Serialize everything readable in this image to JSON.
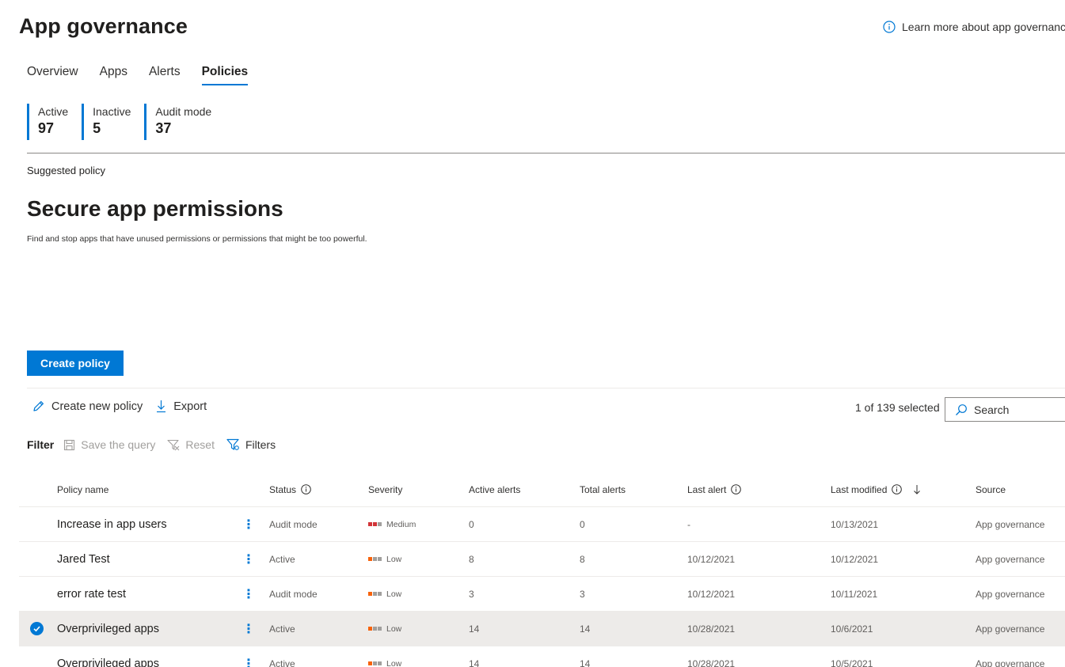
{
  "header": {
    "title": "App governance",
    "learn_more": "Learn more about app governance"
  },
  "tabs": [
    {
      "label": "Overview",
      "active": false
    },
    {
      "label": "Apps",
      "active": false
    },
    {
      "label": "Alerts",
      "active": false
    },
    {
      "label": "Policies",
      "active": true
    }
  ],
  "stats": [
    {
      "label": "Active",
      "value": "97"
    },
    {
      "label": "Inactive",
      "value": "5"
    },
    {
      "label": "Audit mode",
      "value": "37"
    }
  ],
  "suggested": {
    "label": "Suggested policy",
    "title": "Secure app permissions",
    "description": "Find and stop apps that have unused permissions or permissions that might be too powerful."
  },
  "create_button": "Create policy",
  "toolbar": {
    "create_new": "Create new policy",
    "export": "Export",
    "selected_count": "1 of 139 selected",
    "search_placeholder": "Search"
  },
  "filterbar": {
    "label": "Filter",
    "save_query": "Save the query",
    "reset": "Reset",
    "filters": "Filters"
  },
  "columns": {
    "name": "Policy name",
    "status": "Status",
    "severity": "Severity",
    "active_alerts": "Active alerts",
    "total_alerts": "Total alerts",
    "last_alert": "Last alert",
    "last_modified": "Last modified",
    "source": "Source"
  },
  "rows": [
    {
      "name": "Increase in app users",
      "status": "Audit mode",
      "severity": "Medium",
      "active_alerts": "0",
      "total_alerts": "0",
      "last_alert": "-",
      "last_modified": "10/13/2021",
      "source": "App governance",
      "selected": false
    },
    {
      "name": "Jared Test",
      "status": "Active",
      "severity": "Low",
      "active_alerts": "8",
      "total_alerts": "8",
      "last_alert": "10/12/2021",
      "last_modified": "10/12/2021",
      "source": "App governance",
      "selected": false
    },
    {
      "name": "error rate test",
      "status": "Audit mode",
      "severity": "Low",
      "active_alerts": "3",
      "total_alerts": "3",
      "last_alert": "10/12/2021",
      "last_modified": "10/11/2021",
      "source": "App governance",
      "selected": false
    },
    {
      "name": "Overprivileged apps",
      "status": "Active",
      "severity": "Low",
      "active_alerts": "14",
      "total_alerts": "14",
      "last_alert": "10/28/2021",
      "last_modified": "10/6/2021",
      "source": "App governance",
      "selected": true
    },
    {
      "name": "Overprivileged apps",
      "status": "Active",
      "severity": "Low",
      "active_alerts": "14",
      "total_alerts": "14",
      "last_alert": "10/28/2021",
      "last_modified": "10/5/2021",
      "source": "App governance",
      "selected": false
    }
  ],
  "colors": {
    "accent": "#0078d4",
    "severity_medium": "#d13438",
    "severity_low": "#f7630c",
    "severity_inactive": "#a19f9d"
  }
}
